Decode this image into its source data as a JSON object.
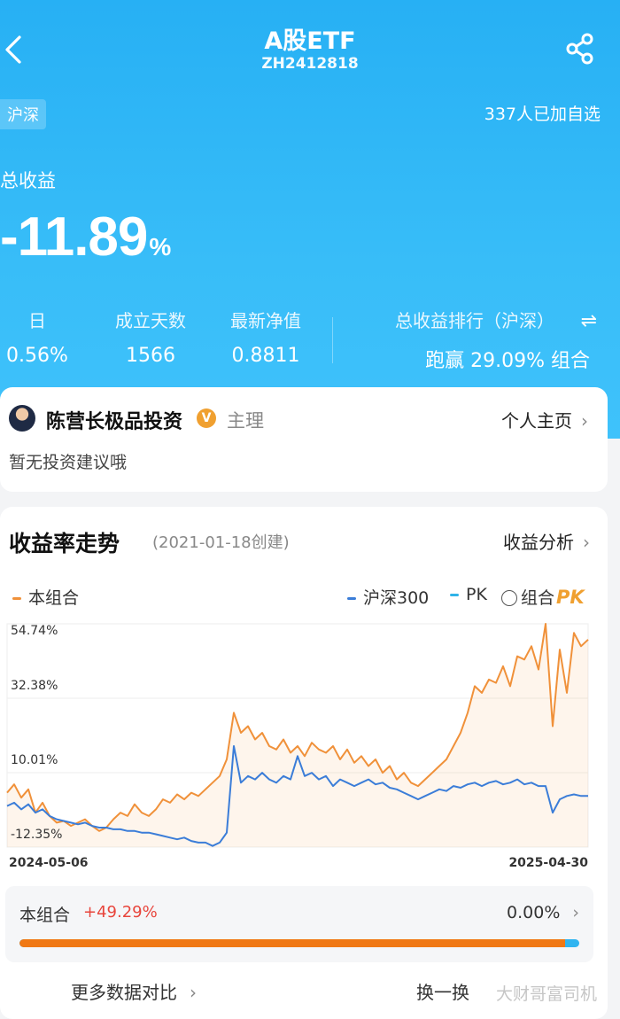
{
  "header": {
    "title": "A股ETF",
    "code": "ZH2412818",
    "market_tag": "沪深",
    "follow_count": "337人已加自选"
  },
  "summary": {
    "total_return_label": "总收益",
    "total_return_value": "-11.89",
    "total_return_unit": "%",
    "stats": [
      {
        "label": "日",
        "value": "0.56%"
      },
      {
        "label": "成立天数",
        "value": "1566"
      },
      {
        "label": "最新净值",
        "value": "0.8811"
      }
    ],
    "rank_label": "总收益排行（沪深）",
    "rank_value": "跑赢 29.09% 组合",
    "swap_icon": "⇌"
  },
  "manager": {
    "name": "陈营长极品投资",
    "badge": "V",
    "role": "主理",
    "homepage_label": "个人主页",
    "advice": "暂无投资建议哦"
  },
  "trend": {
    "title": "收益率走势",
    "created": "(2021-01-18创建)",
    "analysis_label": "收益分析",
    "legend": {
      "portfolio": "本组合",
      "index": "沪深300",
      "pk": "PK",
      "combo": "组合",
      "pk_logo": "PK"
    },
    "compare": {
      "label": "本组合",
      "portfolio_return": "+49.29%",
      "other_return": "0.00%",
      "portfolio_share": 0.975
    },
    "more_label": "更多数据对比",
    "swap_label": "换一换",
    "watermark": "大财哥富司机"
  },
  "colors": {
    "hero": "#38bdf8",
    "portfolio": "#f0913a",
    "index": "#3b7dd8",
    "negative": "#e8453c"
  },
  "chart_data": {
    "type": "line",
    "x_start": "2024-05-06",
    "x_end": "2025-04-30",
    "y_ticks": [
      "54.74%",
      "32.38%",
      "10.01%",
      "-12.35%"
    ],
    "ylim": [
      -12.35,
      54.74
    ],
    "series": [
      {
        "name": "本组合",
        "values": [
          4.0,
          6.5,
          2.5,
          5.0,
          -2.0,
          1.0,
          -3.0,
          -5.0,
          -4.5,
          -6.0,
          -5.0,
          -4.0,
          -6.0,
          -7.5,
          -6.5,
          -4.0,
          -2.0,
          -3.0,
          0.5,
          -2.0,
          -3.0,
          -1.0,
          2.0,
          1.0,
          3.5,
          2.0,
          4.0,
          3.0,
          5.0,
          7.0,
          9.0,
          14.0,
          28.0,
          22.0,
          24.0,
          20.0,
          22.0,
          18.0,
          17.0,
          20.0,
          16.0,
          18.0,
          15.0,
          19.0,
          17.0,
          16.0,
          18.0,
          14.0,
          17.0,
          13.0,
          15.0,
          12.0,
          14.0,
          10.0,
          12.0,
          8.0,
          10.0,
          7.0,
          6.0,
          8.0,
          10.0,
          12.0,
          14.0,
          18.0,
          22.0,
          28.0,
          36.0,
          34.0,
          38.0,
          37.0,
          42.0,
          36.0,
          45.0,
          44.0,
          48.0,
          41.0,
          54.74,
          24.0,
          47.0,
          34.0,
          52.0,
          48.0,
          50.0
        ]
      },
      {
        "name": "沪深300",
        "values": [
          0.0,
          1.0,
          -1.0,
          0.5,
          -2.0,
          -1.0,
          -3.0,
          -4.0,
          -4.5,
          -5.0,
          -5.5,
          -5.0,
          -6.0,
          -6.5,
          -6.5,
          -7.0,
          -7.0,
          -7.5,
          -7.5,
          -8.0,
          -8.0,
          -8.5,
          -9.0,
          -9.5,
          -10.0,
          -9.5,
          -10.5,
          -11.0,
          -11.0,
          -12.0,
          -11.0,
          -8.0,
          18.0,
          7.0,
          9.0,
          8.0,
          10.0,
          8.0,
          7.0,
          9.0,
          8.0,
          15.0,
          9.0,
          10.0,
          8.0,
          9.0,
          6.0,
          8.0,
          7.0,
          6.0,
          7.0,
          8.0,
          6.5,
          7.0,
          5.5,
          5.0,
          4.0,
          3.0,
          2.0,
          3.0,
          4.0,
          5.0,
          4.5,
          6.0,
          5.5,
          6.5,
          7.0,
          6.0,
          7.0,
          7.5,
          6.5,
          7.0,
          8.0,
          6.5,
          7.0,
          6.0,
          6.0,
          -2.0,
          2.0,
          3.0,
          3.5,
          3.0,
          3.0
        ]
      }
    ]
  }
}
